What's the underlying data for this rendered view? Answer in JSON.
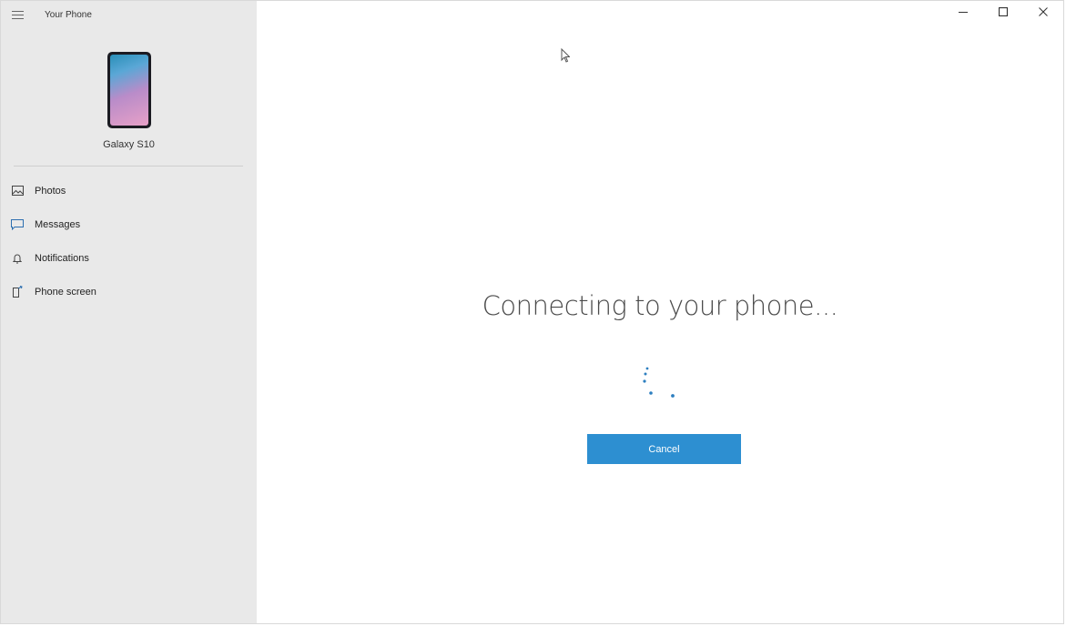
{
  "app": {
    "title": "Your Phone"
  },
  "phone": {
    "name": "Galaxy S10"
  },
  "nav": {
    "items": [
      {
        "label": "Photos",
        "icon": "photos-icon"
      },
      {
        "label": "Messages",
        "icon": "messages-icon"
      },
      {
        "label": "Notifications",
        "icon": "bell-icon"
      },
      {
        "label": "Phone screen",
        "icon": "phone-screen-icon"
      }
    ]
  },
  "window_controls": {
    "minimize": "minimize-icon",
    "maximize": "maximize-icon",
    "close": "close-icon"
  },
  "main": {
    "status_text": "Connecting to your phone...",
    "cancel_label": "Cancel"
  },
  "colors": {
    "sidebar_bg": "#e9e9e9",
    "accent": "#2d8fd1",
    "spinner": "#2d7fc0"
  }
}
